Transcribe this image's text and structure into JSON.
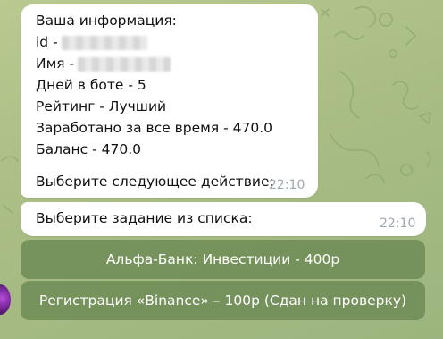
{
  "profile_message": {
    "header": "Ваша информация:",
    "id_prefix": "id -",
    "name_prefix": "Имя -",
    "days_in_bot": "Дней в боте - 5",
    "rating": "Рейтинг - Лучший",
    "earned_total": "Заработано за все время - 470.0",
    "balance": "Баланс - 470.0",
    "prompt": "Выберите следующее действие:",
    "time": "22:10"
  },
  "task_message": {
    "text": "Выберите задание из списка:",
    "time": "22:10"
  },
  "keyboard": {
    "buttons": [
      "Альфа-Банк: Инвестиции - 400р",
      "Регистрация «Binance» – 100р (Сдан на проверку)"
    ]
  },
  "colors": {
    "background": "#a9bd85",
    "bubble": "#ffffff",
    "button": "#6c8a54",
    "timestamp": "#a0a8b0"
  }
}
